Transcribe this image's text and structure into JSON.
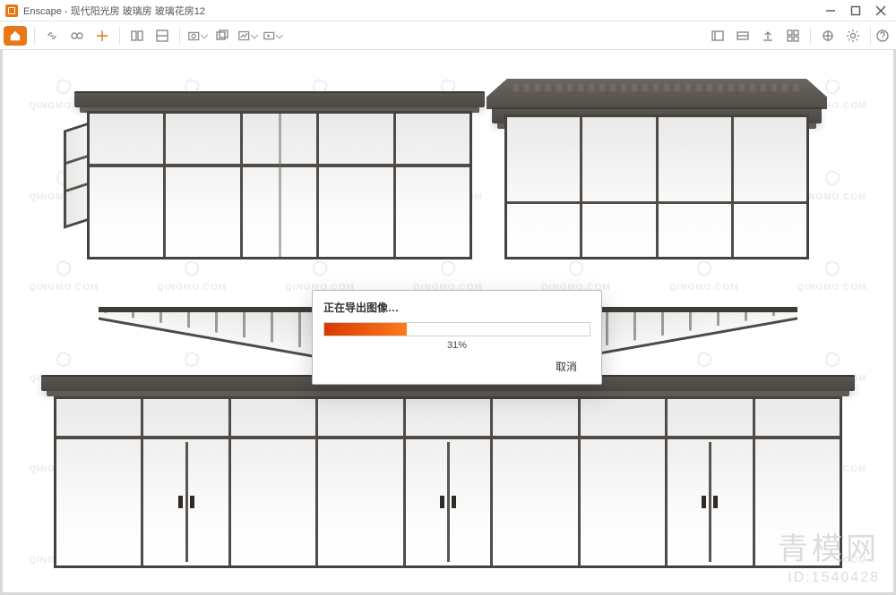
{
  "window": {
    "app_name": "Enscape",
    "document_title": "现代阳光房 玻璃房 玻璃花房12",
    "title_separator": " - "
  },
  "window_controls": {
    "minimize": "minimize",
    "maximize": "maximize",
    "close": "close"
  },
  "export_dialog": {
    "title": "正在导出图像…",
    "progress_percent": 31,
    "percent_label": "31%",
    "cancel_label": "取消"
  },
  "watermark": {
    "text": "QINGMO.COM"
  },
  "brand": {
    "name_cn": "青模网",
    "id_label": "ID:1540428"
  },
  "colors": {
    "accent": "#e77817",
    "progress_start": "#d73a00",
    "progress_end": "#ff7a1a",
    "frame": "#4e4a44"
  }
}
